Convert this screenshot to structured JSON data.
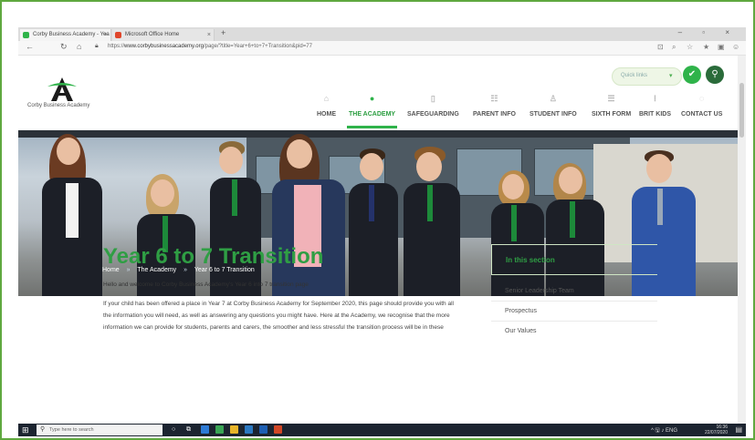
{
  "browser": {
    "tabs": [
      {
        "label": "Corby Business Academy - Yea",
        "favicon_color": "#2fb34a"
      },
      {
        "label": "Microsoft Office Home",
        "favicon_color": "#e0462b"
      }
    ],
    "new_tab": "+",
    "window_controls": "– ▫ ×",
    "url_prefix": "https://",
    "url_domain": "www.corbybusinessacademy.org",
    "url_path": "/page/?title=Year+6+to+7+Transition&pid=77"
  },
  "site": {
    "logo_text": "Corby Business Academy",
    "search_placeholder": "Quick links",
    "menu": [
      {
        "label": "HOME",
        "icon": "home-icon",
        "glyph": "⌂"
      },
      {
        "label": "THE ACADEMY",
        "icon": "chat-icon",
        "glyph": "●",
        "active": true
      },
      {
        "label": "SAFEGUARDING",
        "icon": "shield-icon",
        "glyph": "▯"
      },
      {
        "label": "PARENT INFO",
        "icon": "people-icon",
        "glyph": "☷"
      },
      {
        "label": "STUDENT INFO",
        "icon": "person-icon",
        "glyph": "♙"
      },
      {
        "label": "SIXTH FORM",
        "icon": "cap-icon",
        "glyph": "☰"
      },
      {
        "label": "BRIT KIDS",
        "icon": "star-icon",
        "glyph": "ⵑ"
      },
      {
        "label": "CONTACT US",
        "icon": "location-icon",
        "glyph": "◌"
      }
    ],
    "accent": "#2fb34a",
    "breadcrumb": [
      "Home",
      "The Academy",
      "Year 6 to 7 Transition"
    ],
    "breadcrumb_sep": "»"
  },
  "content": {
    "title": "Year 6 to 7 Transition",
    "intro": "Hello and welcome to Corby Business Academy's Year 6 into 7 transition page",
    "paragraph": "If your child has been offered a place in Year 7 at Corby Business Academy for September 2020, this page should provide you with all the information you will need, as well as answering any questions you might have. Here at the Academy, we recognise that the more information we can provide for students, parents and carers, the smoother and less stressful the transition process will be in these"
  },
  "aside": {
    "heading": "In this section",
    "items": [
      "Senior Leadership Team",
      "Prospectus",
      "Our Values"
    ]
  },
  "taskbar": {
    "search_placeholder": "Type here to search",
    "time": "16:36",
    "date": "22/07/2020",
    "tray": "^ 🖫 ♪ ENG"
  }
}
